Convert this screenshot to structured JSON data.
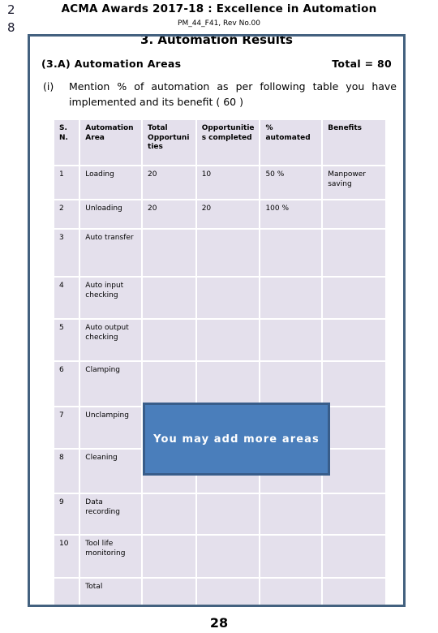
{
  "gutter": {
    "digit_top": "2",
    "digit_bottom": "8"
  },
  "header": {
    "title": "ACMA  Awards  2017-18 : Excellence in Automation",
    "subtitle": "PM_44_F41, Rev No.00"
  },
  "section": {
    "title": "3. Automation Results",
    "subsection_label": "(3.A)   Automation  Areas",
    "subsection_total": "Total  = 80",
    "question_marker": "(i)",
    "question_text": "Mention  %  of automation  as  per following  table   you have  implemented and  its  benefit  ( 60 )"
  },
  "table": {
    "headers": [
      "S. N.",
      "Automation Area",
      "Total Opportuni ties",
      "Opportunitie s completed",
      "% automated",
      "Benefits"
    ],
    "rows": [
      {
        "sn": "1",
        "area": "Loading",
        "total": "20",
        "completed": "10",
        "pct": "50 %",
        "benefits": "Manpower saving"
      },
      {
        "sn": "2",
        "area": "Unloading",
        "total": "20",
        "completed": "20",
        "pct": "100 %",
        "benefits": ""
      },
      {
        "sn": "3",
        "area": "Auto transfer",
        "total": "",
        "completed": "",
        "pct": "",
        "benefits": ""
      },
      {
        "sn": "4",
        "area": "Auto input checking",
        "total": "",
        "completed": "",
        "pct": "",
        "benefits": ""
      },
      {
        "sn": "5",
        "area": "Auto output checking",
        "total": "",
        "completed": "",
        "pct": "",
        "benefits": ""
      },
      {
        "sn": "6",
        "area": "Clamping",
        "total": "",
        "completed": "",
        "pct": "",
        "benefits": ""
      },
      {
        "sn": "7",
        "area": "Unclamping",
        "total": "",
        "completed": "",
        "pct": "",
        "benefits": ""
      },
      {
        "sn": "8",
        "area": "Cleaning",
        "total": "",
        "completed": "",
        "pct": "",
        "benefits": ""
      },
      {
        "sn": "9",
        "area": "Data recording",
        "total": "",
        "completed": "",
        "pct": "",
        "benefits": ""
      },
      {
        "sn": "10",
        "area": "Tool  life monitoring",
        "total": "",
        "completed": "",
        "pct": "",
        "benefits": ""
      },
      {
        "sn": "",
        "area": "Total",
        "total": "",
        "completed": "",
        "pct": "",
        "benefits": ""
      }
    ]
  },
  "callout": {
    "text": "You  may  add  more  areas",
    "fill": "#4a7ebb",
    "border": "#385d8a"
  },
  "footer": {
    "page_number": "28"
  },
  "colors": {
    "frame_border": "#43617f",
    "cell_fill": "#e4e0ec"
  }
}
